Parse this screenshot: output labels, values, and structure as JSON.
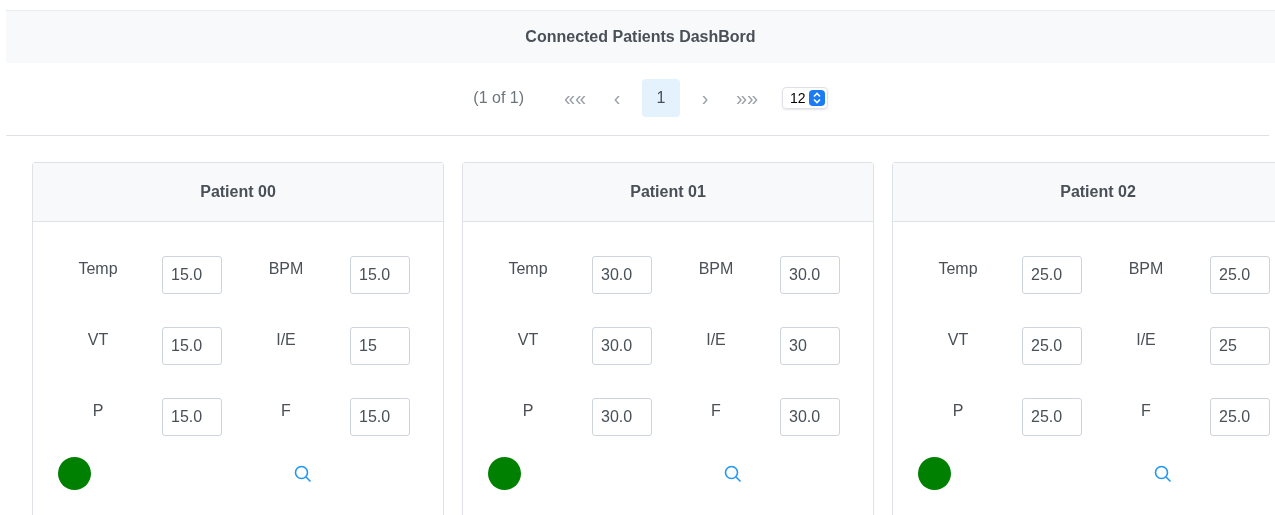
{
  "header": {
    "title": "Connected Patients DashBord"
  },
  "paginator": {
    "report": "(1 of 1)",
    "first": "«",
    "prev": "‹",
    "pages": [
      {
        "label": "1",
        "selected": true
      }
    ],
    "next": "›",
    "last": "»",
    "rows_per_page": "12"
  },
  "patients": [
    {
      "name": "Patient 00",
      "color": "#008000",
      "fields": [
        {
          "label": "Temp",
          "value": "15.0"
        },
        {
          "label": "BPM",
          "value": "15.0"
        },
        {
          "label": "VT",
          "value": "15.0"
        },
        {
          "label": "I/E",
          "value": "15"
        },
        {
          "label": "P",
          "value": "15.0"
        },
        {
          "label": "F",
          "value": "15.0"
        }
      ]
    },
    {
      "name": "Patient 01",
      "color": "#008000",
      "fields": [
        {
          "label": "Temp",
          "value": "30.0"
        },
        {
          "label": "BPM",
          "value": "30.0"
        },
        {
          "label": "VT",
          "value": "30.0"
        },
        {
          "label": "I/E",
          "value": "30"
        },
        {
          "label": "P",
          "value": "30.0"
        },
        {
          "label": "F",
          "value": "30.0"
        }
      ]
    },
    {
      "name": "Patient 02",
      "color": "#008000",
      "fields": [
        {
          "label": "Temp",
          "value": "25.0"
        },
        {
          "label": "BPM",
          "value": "25.0"
        },
        {
          "label": "VT",
          "value": "25.0"
        },
        {
          "label": "I/E",
          "value": "25"
        },
        {
          "label": "P",
          "value": "25.0"
        },
        {
          "label": "F",
          "value": "25.0"
        }
      ]
    }
  ]
}
